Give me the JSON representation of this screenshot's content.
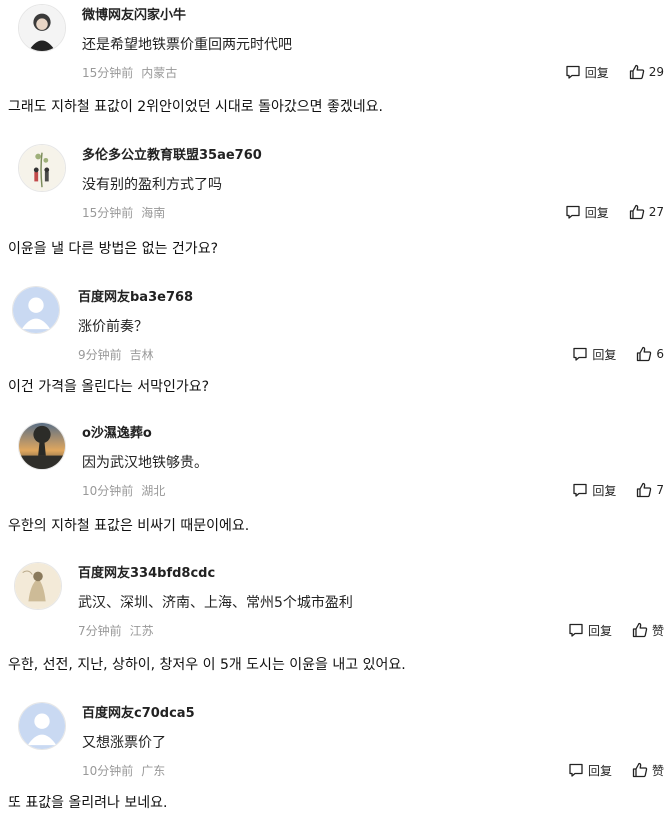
{
  "reply_label": "回复",
  "comments": [
    {
      "username": "微博网友闪家小牛",
      "text": "还是希望地铁票价重回两元时代吧",
      "time": "15分钟前",
      "location": "内蒙古",
      "likes": "29",
      "translation": "그래도 지하철 표값이 2위안이었던 시대로 돌아갔으면 좋겠네요."
    },
    {
      "username": "多伦多公立教育联盟35ae760",
      "text": "没有别的盈利方式了吗",
      "time": "15分钟前",
      "location": "海南",
      "likes": "27",
      "translation": "이윤을 낼 다른 방법은 없는 건가요?"
    },
    {
      "username": "百度网友ba3e768",
      "text": "涨价前奏？",
      "time": "9分钟前",
      "location": "吉林",
      "likes": "6",
      "translation": "이건 가격을 올린다는 서막인가요?"
    },
    {
      "username": "o沙濕逸葬o",
      "text": "因为武汉地铁够贵。",
      "time": "10分钟前",
      "location": "湖北",
      "likes": "7",
      "translation": "우한의 지하철 표값은 비싸기 때문이에요."
    },
    {
      "username": "百度网友334bfd8cdc",
      "text": "武汉、深圳、济南、上海、常州5个城市盈利",
      "time": "7分钟前",
      "location": "江苏",
      "likes": "赞",
      "translation": "우한, 선전, 지난, 상하이, 창저우 이 5개 도시는 이윤을 내고 있어요."
    },
    {
      "username": "百度网友c70dca5",
      "text": "又想涨票价了",
      "time": "10分钟前",
      "location": "广东",
      "likes": "赞",
      "translation": "또 표값을 올리려나 보네요."
    }
  ]
}
